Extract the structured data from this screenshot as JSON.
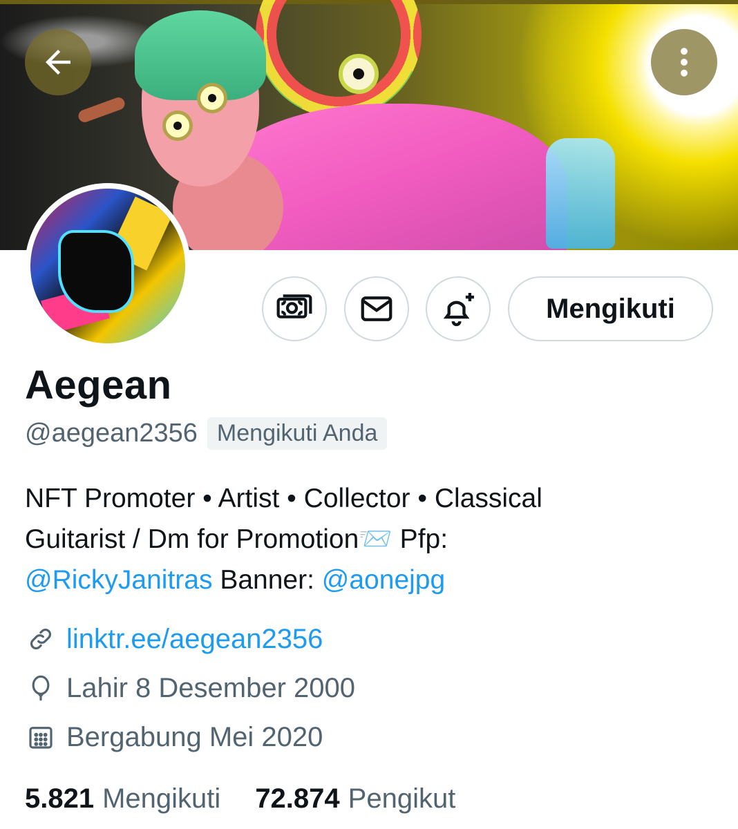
{
  "profile": {
    "display_name": "Aegean",
    "handle": "@aegean2356",
    "follows_you_badge": "Mengikuti Anda",
    "bio": {
      "line1": "NFT Promoter • Artist • Collector • Classical",
      "line2": "Guitarist / Dm for Promotion📨  Pfp:",
      "pfp_mention": "@RickyJanitras",
      "banner_label": "Banner:",
      "banner_mention": "@aonejpg"
    },
    "link": "linktr.ee/aegean2356",
    "birthday": "Lahir 8 Desember 2000",
    "joined": "Bergabung Mei 2020"
  },
  "actions": {
    "follow_label": "Mengikuti"
  },
  "stats": {
    "following_count": "5.821",
    "following_label": "Mengikuti",
    "followers_count": "72.874",
    "followers_label": "Pengikut"
  },
  "icons": {
    "back": "back-arrow-icon",
    "more": "more-vertical-icon",
    "tip": "money-icon",
    "dm": "envelope-icon",
    "notify": "bell-plus-icon",
    "link": "link-icon",
    "birthday": "balloon-icon",
    "joined": "calendar-icon"
  },
  "colors": {
    "accent_link": "#1d9bf0",
    "text_primary": "#0f1419",
    "text_secondary": "#536471",
    "border": "#cfd9de"
  }
}
